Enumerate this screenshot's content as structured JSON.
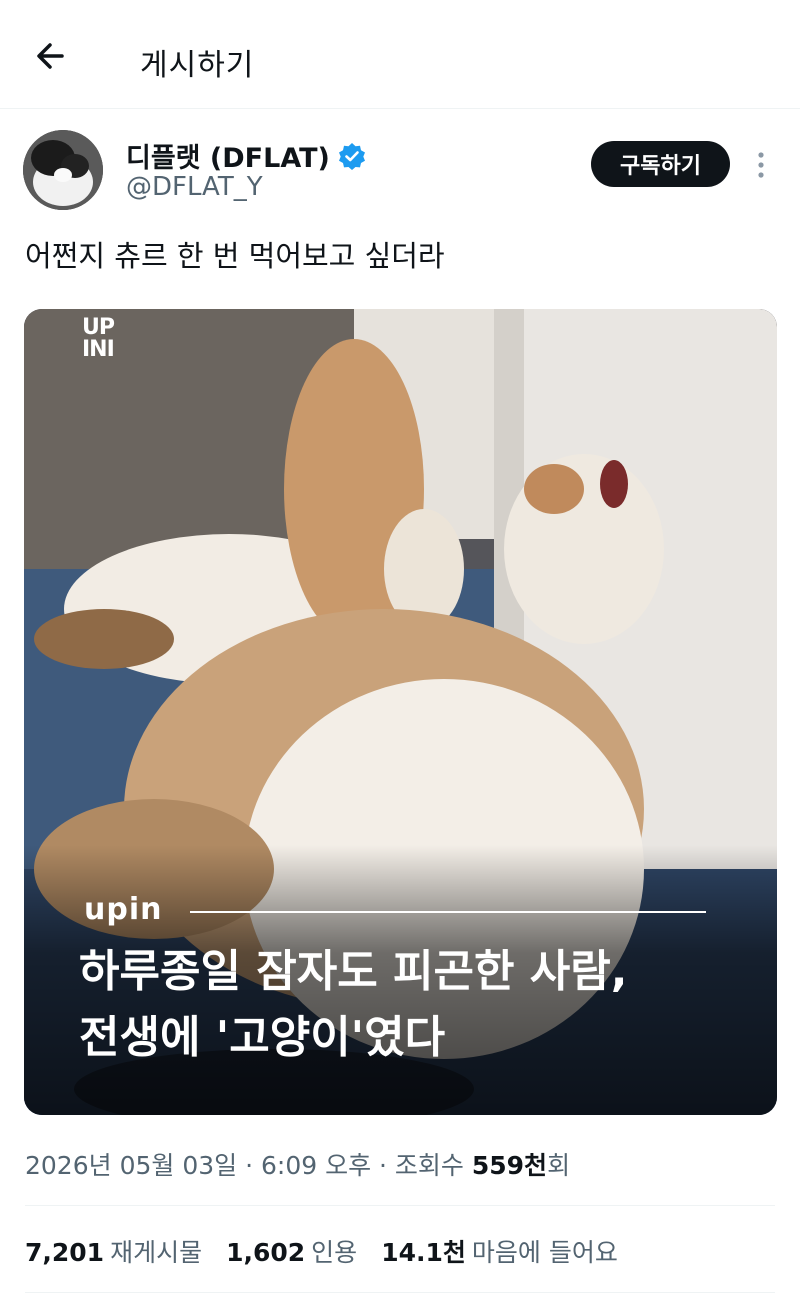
{
  "header": {
    "title": "게시하기"
  },
  "author": {
    "name": "디플랫 (DFLAT)",
    "handle": "@DFLAT_Y",
    "subscribe_label": "구독하기",
    "verified_color": "#1d9bf0"
  },
  "post": {
    "text": "어쩐지 츄르 한 번 먹어보고 싶더라"
  },
  "media": {
    "logo_line1": "UP",
    "logo_line2": "INI",
    "brand": "upin",
    "headline_line1": "하루종일 잠자도 피곤한 사람,",
    "headline_line2": "전생에 '고양이'였다"
  },
  "meta": {
    "date": "2026년 05월 03일",
    "sep1": " · ",
    "time": "6:09 오후",
    "sep2": " · ",
    "views_label": "조회수 ",
    "views_value": "559천",
    "views_suffix": "회"
  },
  "stats": {
    "reposts_value": "7,201",
    "reposts_label": "재게시물",
    "quotes_value": "1,602",
    "quotes_label": "인용",
    "likes_value": "14.1천",
    "likes_label": "마음에 들어요"
  },
  "icons": [
    "back-arrow-icon",
    "verified-badge-icon",
    "more-vertical-icon"
  ]
}
